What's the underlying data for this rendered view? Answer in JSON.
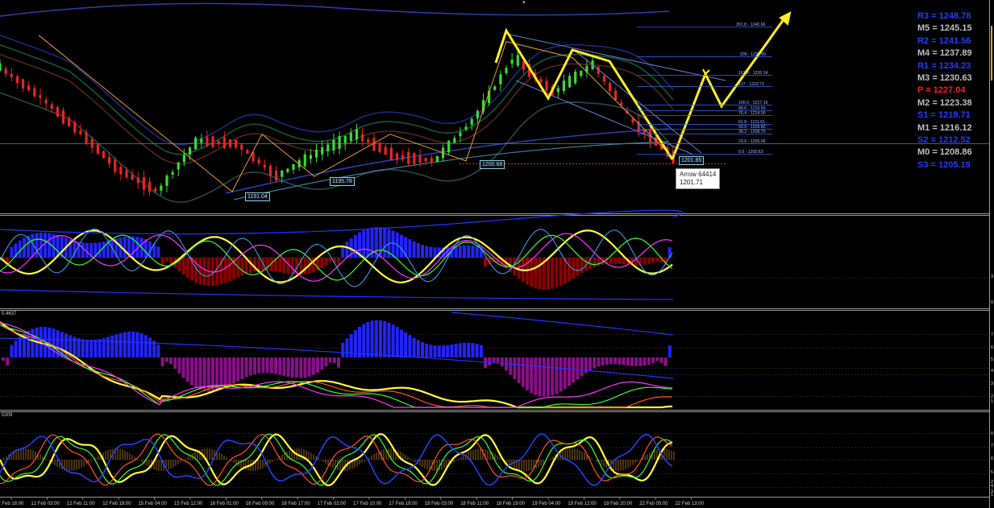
{
  "pivots": [
    {
      "label": "R3 = 1248.78",
      "color": "#1f3cff"
    },
    {
      "label": "M5 = 1245.15",
      "color": "#bfbfbf"
    },
    {
      "label": "R2 = 1241.56",
      "color": "#1f3cff"
    },
    {
      "label": "M4 = 1237.89",
      "color": "#bfbfbf"
    },
    {
      "label": "R1 = 1234.23",
      "color": "#1f3cff"
    },
    {
      "label": "M3 = 1230.63",
      "color": "#bfbfbf"
    },
    {
      "label": "P  = 1227.04",
      "color": "#ff1a1a"
    },
    {
      "label": "M2 = 1223.38",
      "color": "#bfbfbf"
    },
    {
      "label": "S1 = 1219.71",
      "color": "#1f3cff"
    },
    {
      "label": "M1 = 1216.12",
      "color": "#bfbfbf"
    },
    {
      "label": "S2 = 1212.52",
      "color": "#1f3cff"
    },
    {
      "label": "M0 = 1208.86",
      "color": "#bfbfbf"
    },
    {
      "label": "S3 = 1205.19",
      "color": "#1f3cff"
    }
  ],
  "fib_levels": [
    "261.8 - 1240.66",
    "200 - 1233.89",
    "161.8 - 1226.14",
    "127 - 1222.71",
    "100.0 - 1217.16",
    "88.6 - 1215.50",
    "76.4 - 1214.00",
    "61.8 - 1211.61",
    "50.0 - 1209.80",
    "38.2 - 1208.70",
    "23.6 - 1206.06",
    "0.0 - 1202.63"
  ],
  "price_labels": [
    "1191.04",
    "1195.78",
    "1200.68",
    "1201.85"
  ],
  "tooltip": {
    "line1": "Arrow 64414",
    "line2": "1201.71"
  },
  "indicator_labels": [
    "0.4637",
    "5309"
  ],
  "time_axis": [
    "12 Feb 18:00",
    "12 Feb 03:00",
    "12 Feb 11:00",
    "12 Feb 19:00",
    "15 Feb 04:00",
    "15 Feb 12:00",
    "16 Feb 01:00",
    "16 Feb 09:00",
    "16 Feb 17:00",
    "17 Feb 02:00",
    "17 Feb 10:00",
    "17 Feb 18:00",
    "18 Feb 03:00",
    "18 Feb 11:00",
    "18 Feb 19:00",
    "19 Feb 04:00",
    "19 Feb 12:00",
    "19 Feb 20:00",
    "22 Feb 05:00",
    "22 Feb 13:00"
  ],
  "right_axis_ticks": [
    "3",
    "0",
    "7",
    "6",
    "5",
    "4",
    "3",
    "2",
    "1",
    "0",
    "7",
    "6",
    "5",
    "4",
    "3",
    "2",
    "1"
  ],
  "chart_data": {
    "type": "candlestick",
    "title": "",
    "price_path": [
      1230,
      1221,
      1210,
      1198,
      1191.04,
      1207,
      1206,
      1195.78,
      1203,
      1209,
      1202,
      1200.68,
      1214,
      1233,
      1222,
      1231,
      1213,
      1201.85
    ],
    "zigzag_points": [
      {
        "time": "12 Feb 18:00",
        "price": 1240
      },
      {
        "time": "16 Feb 01:00",
        "price": 1191.04
      },
      {
        "time": "16 Feb 09:00",
        "price": 1209
      },
      {
        "time": "16 Feb 17:00",
        "price": 1195.78
      },
      {
        "time": "17 Feb 10:00",
        "price": 1209
      },
      {
        "time": "18 Feb 03:00",
        "price": 1200.68
      },
      {
        "time": "18 Feb 11:00",
        "price": 1238
      },
      {
        "time": "19 Feb 12:00",
        "price": 1233
      },
      {
        "time": "22 Feb 05:00",
        "price": 1201.85
      }
    ],
    "projection_arrows": [
      "up",
      "up"
    ],
    "subwindows": [
      "oscillator histogram (blue/dark red)",
      "oscillator histogram (blue/purple)",
      "stochastic with histogram"
    ]
  }
}
